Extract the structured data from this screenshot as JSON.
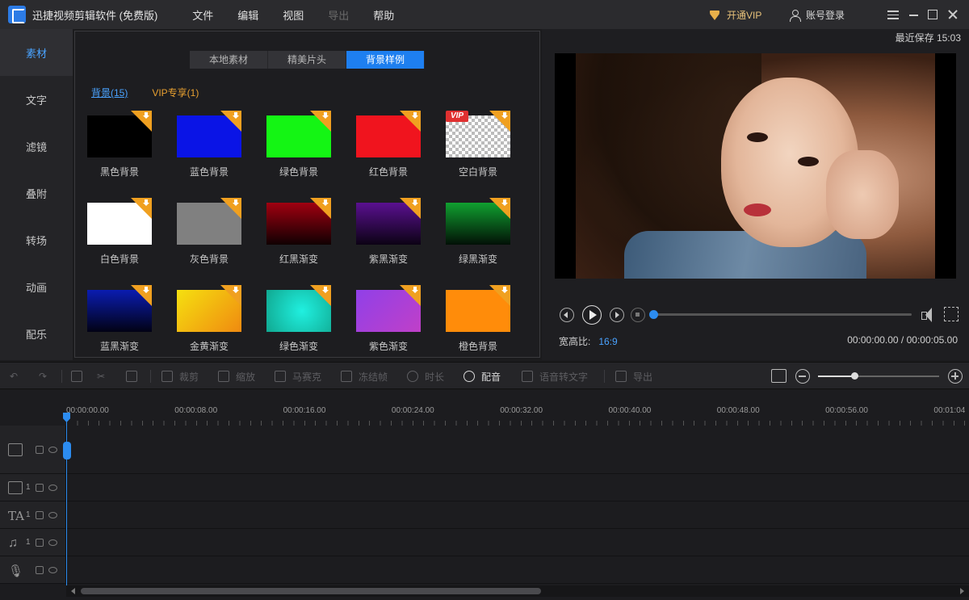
{
  "app": {
    "title": "迅捷视频剪辑软件 (免费版)",
    "menu": [
      {
        "label": "文件",
        "enabled": true
      },
      {
        "label": "编辑",
        "enabled": true
      },
      {
        "label": "视图",
        "enabled": true
      },
      {
        "label": "导出",
        "enabled": false
      },
      {
        "label": "帮助",
        "enabled": true
      }
    ],
    "vip_label": "开通VIP",
    "login_label": "账号登录"
  },
  "sidebar": {
    "items": [
      {
        "label": "素材",
        "active": true
      },
      {
        "label": "文字",
        "active": false
      },
      {
        "label": "滤镜",
        "active": false
      },
      {
        "label": "叠附",
        "active": false
      },
      {
        "label": "转场",
        "active": false
      },
      {
        "label": "动画",
        "active": false
      },
      {
        "label": "配乐",
        "active": false
      }
    ]
  },
  "material": {
    "tabs": [
      {
        "label": "本地素材",
        "active": false
      },
      {
        "label": "精美片头",
        "active": false
      },
      {
        "label": "背景样例",
        "active": true
      }
    ],
    "subtabs": {
      "background": "背景(15)",
      "vip": "VIP专享(1)"
    },
    "thumbnails": [
      {
        "label": "黑色背景",
        "fill": "#000000",
        "vip": false
      },
      {
        "label": "蓝色背景",
        "fill": "#0a14e6",
        "vip": false
      },
      {
        "label": "绿色背景",
        "fill": "#14f514",
        "vip": false
      },
      {
        "label": "红色背景",
        "fill": "#f0141e",
        "vip": false
      },
      {
        "label": "空白背景",
        "fill": "checker",
        "vip": true
      },
      {
        "label": "白色背景",
        "fill": "#ffffff",
        "vip": false
      },
      {
        "label": "灰色背景",
        "fill": "#808080",
        "vip": false
      },
      {
        "label": "红黑渐变",
        "fill": "linear-gradient(180deg,#a00010,#100002)",
        "vip": false
      },
      {
        "label": "紫黑渐变",
        "fill": "linear-gradient(180deg,#5a1090,#0c0214)",
        "vip": false
      },
      {
        "label": "绿黑渐变",
        "fill": "linear-gradient(180deg,#10a030,#021006)",
        "vip": false
      },
      {
        "label": "蓝黑渐变",
        "fill": "linear-gradient(180deg,#0a1cb0,#020214)",
        "vip": false
      },
      {
        "label": "金黄渐变",
        "fill": "linear-gradient(135deg,#f5e010,#f08a10)",
        "vip": false
      },
      {
        "label": "绿色渐变",
        "fill": "radial-gradient(circle at 55% 50%,#20f0e0,#10a890)",
        "vip": false
      },
      {
        "label": "紫色渐变",
        "fill": "linear-gradient(135deg,#9040e8,#c040c8)",
        "vip": false
      },
      {
        "label": "橙色背景",
        "fill": "#ff8c0a",
        "vip": false
      }
    ],
    "vip_tag": "VIP"
  },
  "preview": {
    "save_time": "最近保存 15:03",
    "aspect_label": "宽高比:",
    "aspect_value": "16:9",
    "timecode": "00:00:00.00 / 00:00:05.00",
    "progress": 0
  },
  "toolbar": {
    "items": [
      {
        "name": "crop-button",
        "label": "裁剪",
        "enabled": false
      },
      {
        "name": "scale-button",
        "label": "缩放",
        "enabled": false
      },
      {
        "name": "mosaic-button",
        "label": "马赛克",
        "enabled": false
      },
      {
        "name": "freeze-frame-button",
        "label": "冻结帧",
        "enabled": false
      },
      {
        "name": "duration-button",
        "label": "时长",
        "enabled": false
      },
      {
        "name": "dubbing-button",
        "label": "配音",
        "enabled": true
      },
      {
        "name": "speech-to-text-button",
        "label": "语音转文字",
        "enabled": false
      },
      {
        "name": "export-button",
        "label": "导出",
        "enabled": false
      }
    ],
    "zoom_level": 0.3
  },
  "timeline": {
    "ruler": [
      "00:00:00.00",
      "00:00:08.00",
      "00:00:16.00",
      "00:00:24.00",
      "00:00:32.00",
      "00:00:40.00",
      "00:00:48.00",
      "00:00:56.00",
      "00:01:04"
    ],
    "tracks": [
      {
        "type": "video-main",
        "number": ""
      },
      {
        "type": "video-overlay",
        "number": "1"
      },
      {
        "type": "text",
        "number": "1",
        "glyph": "TA"
      },
      {
        "type": "music",
        "number": "1",
        "glyph": "♫"
      },
      {
        "type": "voice",
        "number": "",
        "glyph": "🎙"
      }
    ]
  }
}
